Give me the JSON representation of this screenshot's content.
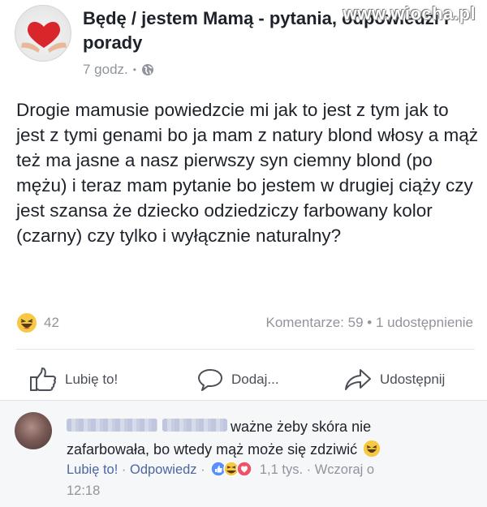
{
  "watermark": "www.wiocha.pl",
  "post": {
    "group_name": "Będę / jestem Mamą - pytania, odpowiedzi i porady",
    "time": "7 godz.",
    "text": "Drogie mamusie powiedzcie mi jak to jest z tym jak to jest z tymi genami bo  ja mam z natury blond włosy a mąż też ma jasne a nasz pierwszy syn ciemny blond (po mężu) i teraz mam pytanie bo jestem w drugiej ciąży czy jest szansa że dziecko odziedziczy farbowany kolor (czarny) czy tylko i wyłącznie naturalny?",
    "reaction_icon": "haha-emoji-icon",
    "reaction_count": "42",
    "comments_label": "Komentarze: 59",
    "shares_label": "1 udostępnienie"
  },
  "actions": {
    "like": "Lubię to!",
    "comment": "Dodaj...",
    "share": "Udostępnij"
  },
  "comment": {
    "text_line1": "ważne żeby skóra nie",
    "text_line2": "zafarbowała, bo wtedy mąż może się zdziwić",
    "like": "Lubię to!",
    "reply": "Odpowiedz",
    "reaction_icons": [
      "like-icon",
      "haha-emoji-icon",
      "love-icon"
    ],
    "reaction_count": "1,1 tys.",
    "time_line1": "Wczoraj o",
    "time_line2": "12:18"
  },
  "colors": {
    "text": "#1d2129",
    "meta": "#90949c",
    "link": "#4b67a1",
    "comment_bg": "#f6f7f9"
  }
}
